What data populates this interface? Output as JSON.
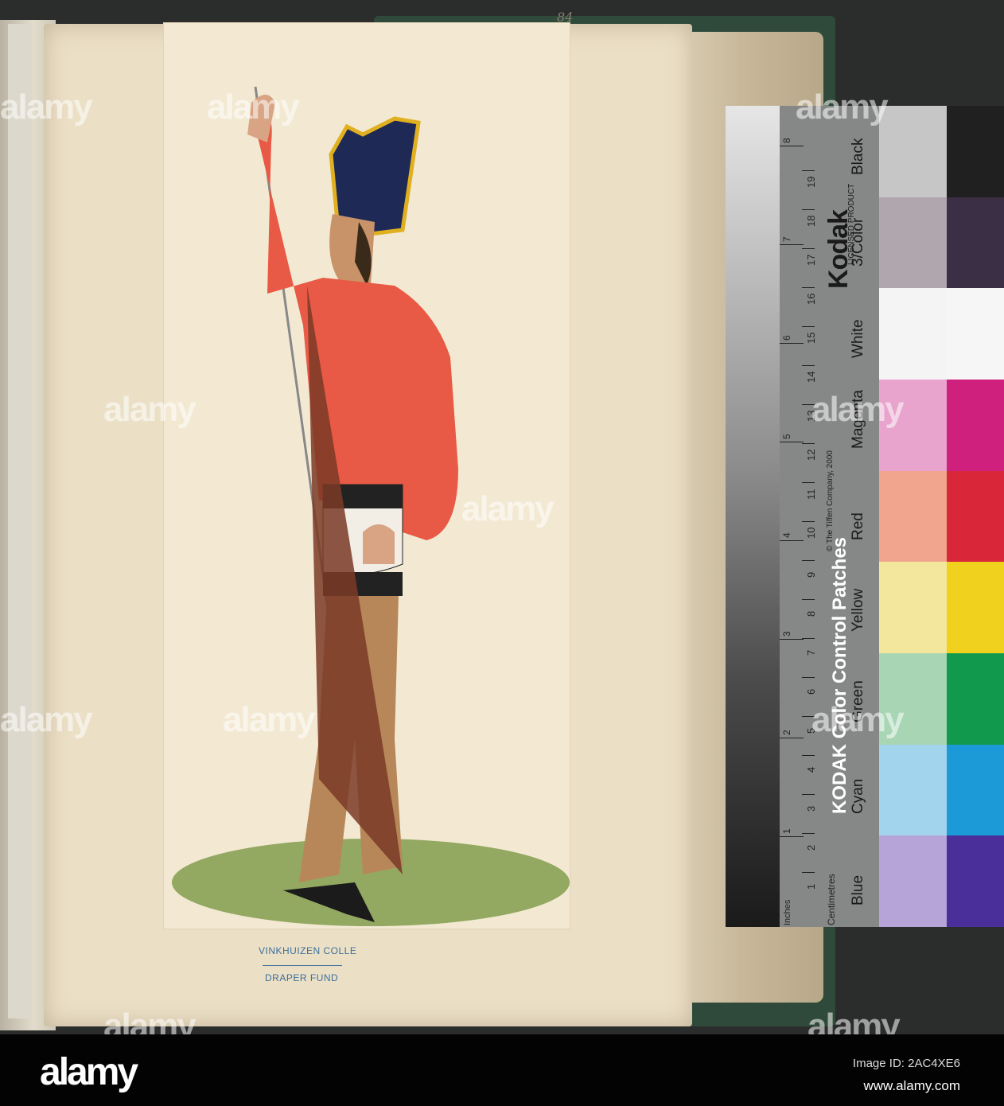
{
  "page": {
    "page_number": "84",
    "stamp_line1": "VINKHUIZEN COLLE",
    "stamp_line2": "DRAPER FUND"
  },
  "kodak": {
    "brand": "Kodak",
    "licensed": "LICENSED PRODUCT",
    "title": "KODAK Color Control Patches",
    "copyright": "© The Tiffen Company, 2000",
    "inches": "Inches",
    "centimetres": "Centimetres",
    "inch_ticks": [
      "1",
      "2",
      "3",
      "4",
      "5",
      "6",
      "7",
      "8"
    ],
    "cm_ticks": [
      "1",
      "2",
      "3",
      "4",
      "5",
      "6",
      "7",
      "8",
      "9",
      "10",
      "11",
      "12",
      "13",
      "14",
      "15",
      "16",
      "17",
      "18",
      "19"
    ],
    "patches": [
      {
        "label": "Black",
        "light": "#c6c6c6",
        "dark": "#202020"
      },
      {
        "label": "3/Color",
        "light": "#b0a6ae",
        "dark": "#3a2f44"
      },
      {
        "label": "White",
        "light": "#f4f4f4",
        "dark": "#f6f6f6"
      },
      {
        "label": "Magenta",
        "light": "#e8a4cc",
        "dark": "#d0207e"
      },
      {
        "label": "Red",
        "light": "#f2a58e",
        "dark": "#d92638"
      },
      {
        "label": "Yellow",
        "light": "#f2e79c",
        "dark": "#f0d21e"
      },
      {
        "label": "Green",
        "light": "#a8d6b4",
        "dark": "#119a4e"
      },
      {
        "label": "Cyan",
        "light": "#a2d4ee",
        "dark": "#1c9ad8"
      },
      {
        "label": "Blue",
        "light": "#b6a4d8",
        "dark": "#4a2f9a"
      }
    ]
  },
  "watermark": "alamy",
  "footer": {
    "logo": "alamy",
    "image_id": "Image ID: 2AC4XE6",
    "url": "www.alamy.com"
  }
}
